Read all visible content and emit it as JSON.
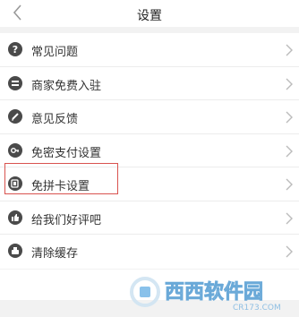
{
  "header": {
    "title": "设置"
  },
  "settings": {
    "items": [
      {
        "label": "常见问题",
        "icon": "question-icon"
      },
      {
        "label": "商家免费入驻",
        "icon": "store-icon"
      },
      {
        "label": "意见反馈",
        "icon": "edit-icon"
      },
      {
        "label": "免密支付设置",
        "icon": "key-icon"
      },
      {
        "label": "免拼卡设置",
        "icon": "card-icon"
      },
      {
        "label": "给我们好评吧",
        "icon": "thumb-up-icon"
      },
      {
        "label": "清除缓存",
        "icon": "clean-icon"
      }
    ]
  },
  "highlight": {
    "target": "免拼卡设置",
    "color": "#d9534f"
  },
  "watermark": {
    "text": "西西软件园",
    "subtext": "CR173.COM"
  }
}
